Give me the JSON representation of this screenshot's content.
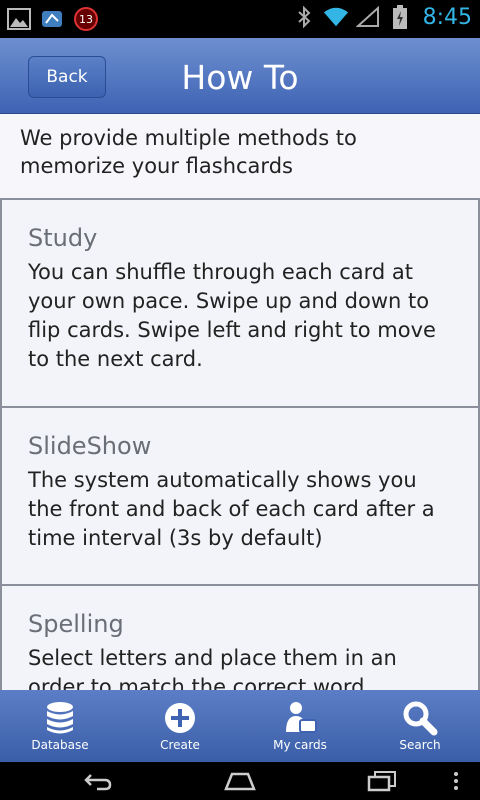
{
  "statusbar": {
    "notification_count": "13",
    "time": "8:45"
  },
  "header": {
    "back_label": "Back",
    "title": "How To"
  },
  "intro": "We provide multiple methods to memorize your flashcards",
  "sections": [
    {
      "title": "Study",
      "text": "You can shuffle through each card at your own pace. Swipe up and down to flip cards. Swipe left and right to move to the next card."
    },
    {
      "title": "SlideShow",
      "text": "The system automatically shows you the front and back of each card after a time interval (3s by default)"
    },
    {
      "title": "Spelling",
      "text": "Select letters and place them in an order to match the correct word."
    }
  ],
  "tabs": [
    {
      "label": "Database",
      "icon": "database-icon"
    },
    {
      "label": "Create",
      "icon": "plus-circle-icon"
    },
    {
      "label": "My cards",
      "icon": "user-card-icon"
    },
    {
      "label": "Search",
      "icon": "search-icon"
    }
  ],
  "colors": {
    "header": "#4a6fbd",
    "accent": "#33b5e5"
  }
}
